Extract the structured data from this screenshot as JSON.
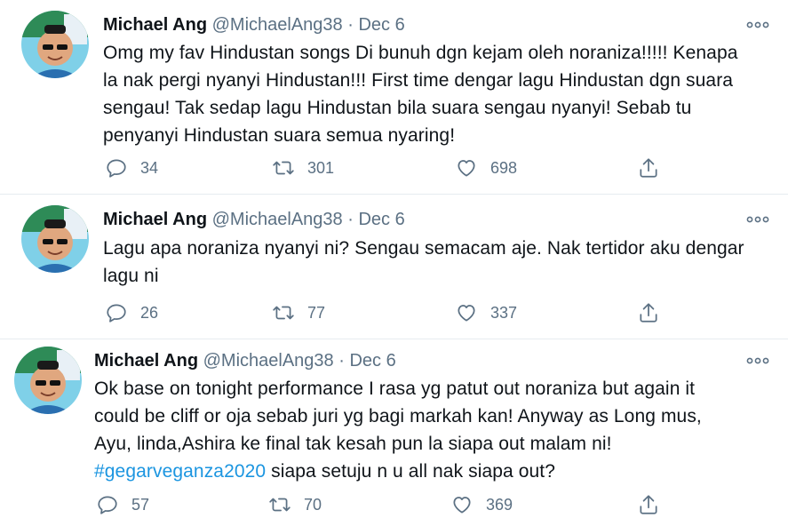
{
  "tweets": [
    {
      "name": "Michael Ang",
      "handle": "@MichaelAng38",
      "dot": "·",
      "date": "Dec 6",
      "lines": [
        "Omg my fav Hindustan songs Di bunuh dgn kejam oleh noraniza!!!!! Kenapa",
        "la nak pergi nyanyi Hindustan!!! First time dengar lagu Hindustan dgn suara",
        "sengau! Tak sedap lagu Hindustan bila suara sengau nyanyi! Sebab tu",
        "penyanyi Hindustan suara semua nyaring!"
      ],
      "replies": "34",
      "retweets": "301",
      "likes": "698"
    },
    {
      "name": "Michael Ang",
      "handle": "@MichaelAng38",
      "dot": "·",
      "date": "Dec 6",
      "lines": [
        "Lagu apa noraniza nyanyi ni? Sengau semacam aje. Nak tertidor aku dengar",
        "lagu ni"
      ],
      "replies": "26",
      "retweets": "77",
      "likes": "337"
    },
    {
      "name": "Michael Ang",
      "handle": "@MichaelAng38",
      "dot": "·",
      "date": "Dec 6",
      "lines": [
        "Ok base on tonight performance I rasa yg patut out noraniza but again it",
        "could be cliff or oja sebab juri yg bagi markah kan! Anyway as Long mus,",
        "Ayu, linda,Ashira ke final tak kesah pun la siapa out malam ni!"
      ],
      "hashtag": "#gegarveganza2020",
      "last_line_rest": " siapa setuju n u all nak siapa out?",
      "replies": "57",
      "retweets": "70",
      "likes": "369"
    }
  ],
  "icons": {
    "reply": "reply-icon",
    "retweet": "retweet-icon",
    "like": "heart-icon",
    "share": "share-icon",
    "more": "more-icon"
  },
  "colors": {
    "text": "#0f1419",
    "secondary": "#5b7083",
    "link": "#1b95e0",
    "divider": "#e6ecf0"
  }
}
